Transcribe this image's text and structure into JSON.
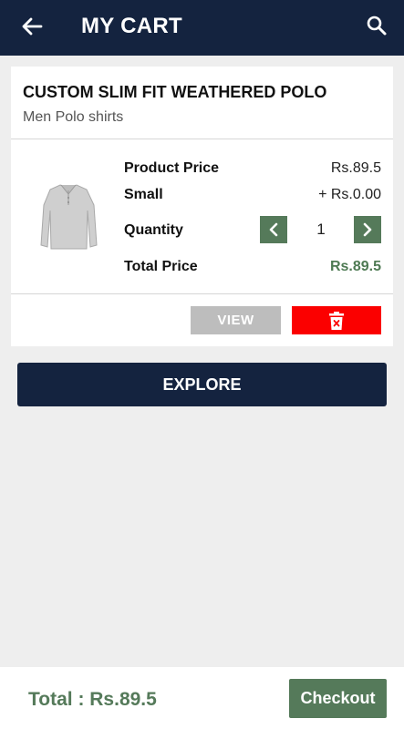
{
  "appbar": {
    "title": "MY CART",
    "back_icon": "arrow-left-icon",
    "search_icon": "search-icon"
  },
  "cart_item": {
    "name": "CUSTOM SLIM FIT WEATHERED POLO",
    "category": "Men Polo shirts",
    "product_price_label": "Product Price",
    "product_price": "Rs.89.5",
    "size_label": "Small",
    "size_price": "+ Rs.0.00",
    "quantity_label": "Quantity",
    "quantity": "1",
    "total_price_label": "Total Price",
    "total_price": "Rs.89.5",
    "view_label": "VIEW",
    "delete_icon": "trash-icon"
  },
  "explore_label": "EXPLORE",
  "footer": {
    "total": "Total : Rs.89.5",
    "checkout_label": "Checkout"
  },
  "colors": {
    "navy": "#14233f",
    "green": "#557a5a",
    "red": "#fb0000",
    "grey": "#bdbdbd"
  }
}
